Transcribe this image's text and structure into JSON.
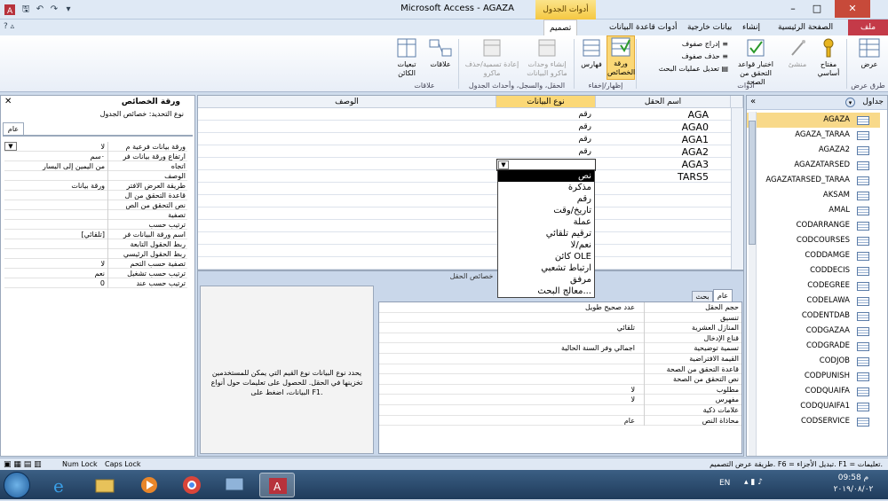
{
  "window": {
    "title": "Microsoft Access - AGAZA",
    "context_tab_header": "أدوات الجدول"
  },
  "tabs": {
    "file": "ملف",
    "home": "الصفحة الرئيسية",
    "create": "إنشاء",
    "external": "بيانات خارجية",
    "dbtools": "أدوات قاعدة البيانات",
    "design": "تصميم"
  },
  "ribbon": {
    "views": {
      "button": "عرض",
      "group": "طرق عرض"
    },
    "tools": {
      "primary_key": "مفتاح أساسي",
      "builder": "منشئ",
      "test_rules": "اختبار قواعد التحقق من الصحة",
      "insert_rows": "إدراج صفوف",
      "delete_rows": "حذف صفوف",
      "modify_lookups": "تعديل عمليات البحث",
      "group": "أدوات"
    },
    "showhide": {
      "property_sheet": "ورقة الخصائص",
      "indexes": "فهارس",
      "group": "إظهار/إخفاء"
    },
    "events": {
      "create_macros": "إنشاء وحدات ماكرو البيانات",
      "rename_macro": "إعادة تسمية/حذف ماكرو",
      "group": "الحقل، والسجل، وأحداث الجدول"
    },
    "relationships": {
      "relationships": "علاقات",
      "dependencies": "تبعيات الكائن",
      "group": "علاقات"
    }
  },
  "property_sheet": {
    "title": "ورقة الخصائص",
    "selection_type": "نوع التحديد:  خصائص الجدول",
    "tab": "عام",
    "rows": [
      {
        "label": "ورقة بيانات فرعية م",
        "value": "لا"
      },
      {
        "label": "ارتفاع ورقة بيانات فر",
        "value": "٠سم"
      },
      {
        "label": "اتجاه",
        "value": "من اليمين إلى اليسار"
      },
      {
        "label": "الوصف",
        "value": ""
      },
      {
        "label": "طريقة العرض الافتر",
        "value": "ورقة بيانات"
      },
      {
        "label": "قاعدة التحقق من ال",
        "value": ""
      },
      {
        "label": "نص التحقق من الص",
        "value": ""
      },
      {
        "label": "تصفية",
        "value": ""
      },
      {
        "label": "ترتيب حسب",
        "value": ""
      },
      {
        "label": "اسم ورقة البيانات فر",
        "value": "[تلقائي]"
      },
      {
        "label": "ربط الحقول التابعة",
        "value": ""
      },
      {
        "label": "ربط الحقول الرئيسي",
        "value": ""
      },
      {
        "label": "تصفية حسب التحم",
        "value": "لا"
      },
      {
        "label": "ترتيب حسب تشغيل",
        "value": "نعم"
      },
      {
        "label": "ترتيب حسب عند",
        "value": "0"
      }
    ]
  },
  "design_grid": {
    "headers": {
      "field_name": "اسم الحقل",
      "data_type": "نوع البيانات",
      "description": "الوصف"
    },
    "rows": [
      {
        "name": "AGA",
        "type": "رقم"
      },
      {
        "name": "AGA0",
        "type": "رقم"
      },
      {
        "name": "AGA1",
        "type": "رقم"
      },
      {
        "name": "AGA2",
        "type": "رقم"
      },
      {
        "name": "AGA3",
        "type": "رقم"
      },
      {
        "name": "TARS5",
        "type": ""
      }
    ],
    "dropdown_items": [
      "نص",
      "مذكرة",
      "رقم",
      "تاريخ/وقت",
      "عملة",
      "ترقيم تلقائي",
      "نعم/لا",
      "كائن OLE",
      "ارتباط تشعبي",
      "مرفق",
      "معالج البحث..."
    ],
    "dropdown_selected": "نص"
  },
  "field_properties": {
    "title": "خصائص الحقل",
    "tab_general": "عام",
    "tab_lookup": "بحث",
    "rows": [
      {
        "label": "حجم الحقل",
        "value": "عدد صحيح طويل"
      },
      {
        "label": "تنسيق",
        "value": ""
      },
      {
        "label": "المنازل العشرية",
        "value": "تلقائي"
      },
      {
        "label": "قناع الإدخال",
        "value": ""
      },
      {
        "label": "تسمية توضيحية",
        "value": "اجمالي وفر السنة الحالية"
      },
      {
        "label": "القيمة الافتراضية",
        "value": ""
      },
      {
        "label": "قاعدة التحقق من الصحة",
        "value": ""
      },
      {
        "label": "نص التحقق من الصحة",
        "value": ""
      },
      {
        "label": "مطلوب",
        "value": "لا"
      },
      {
        "label": "مفهرس",
        "value": "لا"
      },
      {
        "label": "علامات ذكية",
        "value": ""
      },
      {
        "label": "محاذاة النص",
        "value": "عام"
      }
    ],
    "help": "يحدد نوع البيانات نوع القيم التي يمكن للمستخدمين تخزينها في الحقل. للحصول على تعليمات حول أنواع البيانات، اضغط على F1."
  },
  "nav_pane": {
    "title": "جداول",
    "items": [
      "AGAZA",
      "AGAZA_TARAA",
      "AGAZA2",
      "AGAZATARSED",
      "AGAZATARSED_TARAA",
      "AKSAM",
      "AMAL",
      "CODARRANGE",
      "CODCOURSES",
      "CODDAMGE",
      "CODDECIS",
      "CODEGREE",
      "CODELAWA",
      "CODENTDAB",
      "CODGAZAA",
      "CODGRADE",
      "CODJOB",
      "CODPUNISH",
      "CODQUAIFA",
      "CODQUAIFA1",
      "CODSERVICE"
    ]
  },
  "status_bar": {
    "hint": "طريقة عرض التصميم. F6 = تبديل الأجزاء. F1 = تعليمات.",
    "num_lock": "Num Lock",
    "caps_lock": "Caps Lock"
  },
  "taskbar": {
    "lang": "EN",
    "time": "09:58 م",
    "date": "٢٠١٩/٠٨/٠٢"
  },
  "colors": {
    "file_tab": "#c43a48",
    "context_tab": "#f5c842",
    "selection": "#000000"
  }
}
